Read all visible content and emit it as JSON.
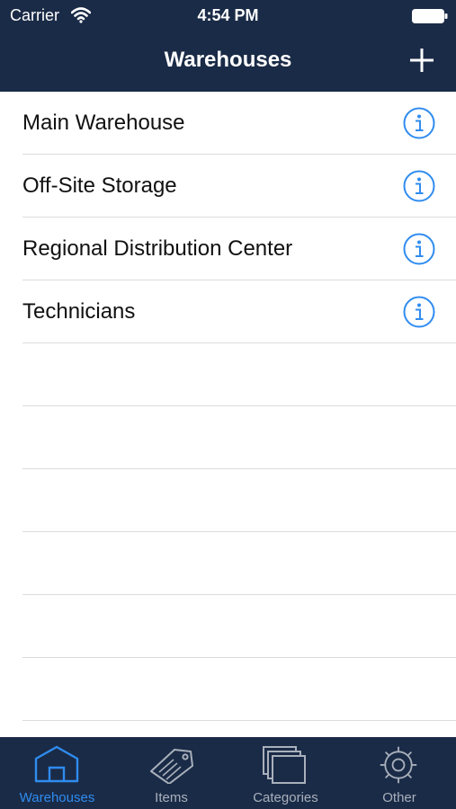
{
  "status_bar": {
    "carrier": "Carrier",
    "time": "4:54 PM",
    "wifi_icon": "wifi-icon",
    "battery_icon": "battery-icon"
  },
  "nav": {
    "title": "Warehouses",
    "add_icon": "plus-icon"
  },
  "list": {
    "items": [
      {
        "label": "Main Warehouse"
      },
      {
        "label": "Off-Site Storage"
      },
      {
        "label": "Regional Distribution Center"
      },
      {
        "label": "Technicians"
      }
    ],
    "info_icon": "info-icon"
  },
  "tab_bar": {
    "tabs": [
      {
        "label": "Warehouses",
        "icon": "warehouse-icon",
        "active": true
      },
      {
        "label": "Items",
        "icon": "tag-icon",
        "active": false
      },
      {
        "label": "Categories",
        "icon": "stacked-cards-icon",
        "active": false
      },
      {
        "label": "Other",
        "icon": "gear-icon",
        "active": false
      }
    ]
  },
  "colors": {
    "bar_background": "#1a2b47",
    "accent": "#2f8cf0",
    "tab_inactive": "#a9b0bb",
    "separator": "#dcdcdc"
  }
}
